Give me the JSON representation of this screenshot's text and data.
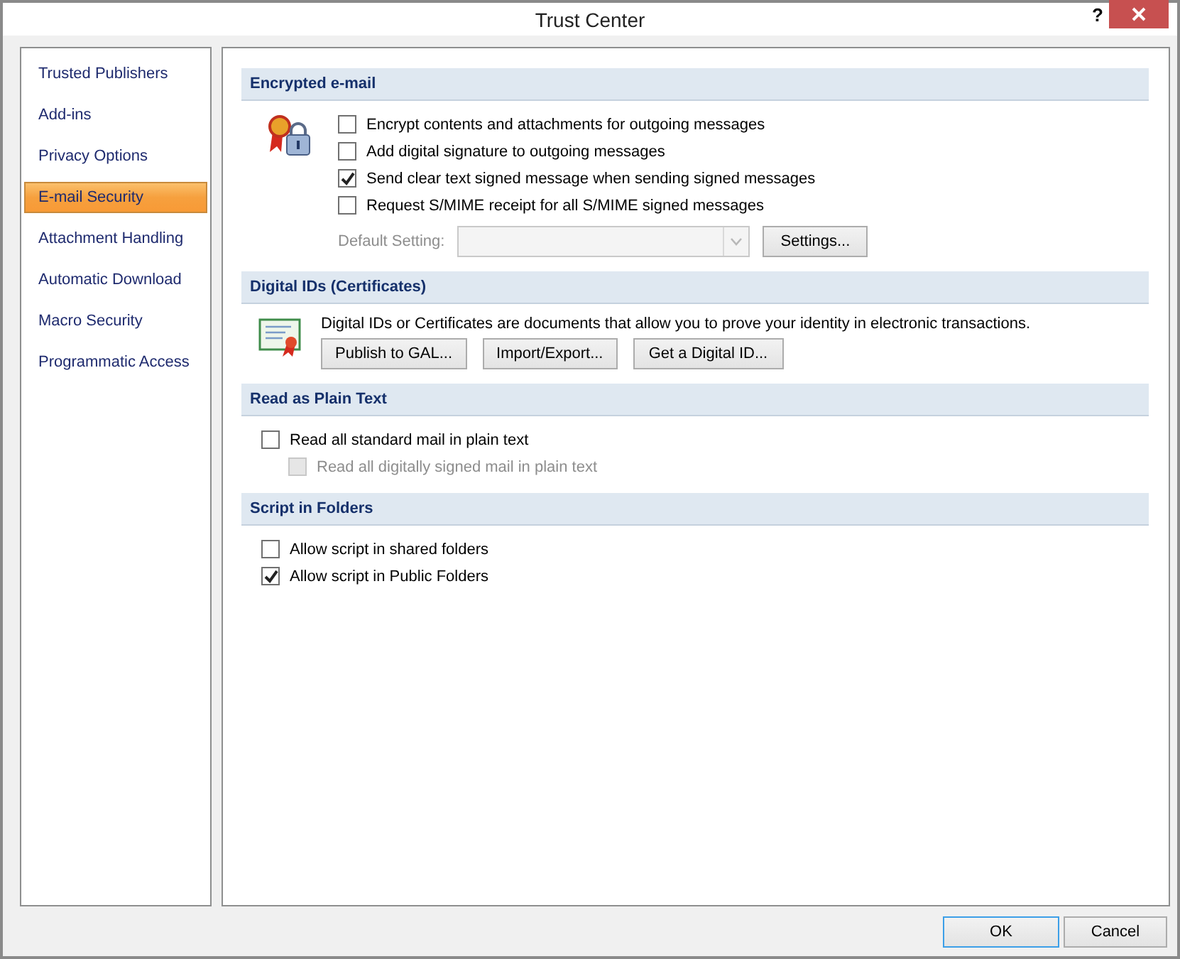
{
  "window": {
    "title": "Trust Center",
    "help": "?"
  },
  "sidebar": {
    "items": [
      {
        "label": "Trusted Publishers",
        "selected": false
      },
      {
        "label": "Add-ins",
        "selected": false
      },
      {
        "label": "Privacy Options",
        "selected": false
      },
      {
        "label": "E-mail Security",
        "selected": true
      },
      {
        "label": "Attachment Handling",
        "selected": false
      },
      {
        "label": "Automatic Download",
        "selected": false
      },
      {
        "label": "Macro Security",
        "selected": false
      },
      {
        "label": "Programmatic Access",
        "selected": false
      }
    ]
  },
  "sections": [
    {
      "title": "Encrypted e-mail",
      "kind": "encryption",
      "items": [
        {
          "kind": "checkbox",
          "label": "Encrypt contents and attachments for outgoing messages",
          "checked": false,
          "disabled": false
        },
        {
          "kind": "checkbox",
          "label": "Add digital signature to outgoing messages",
          "checked": false,
          "disabled": false
        },
        {
          "kind": "checkbox",
          "label": "Send clear text signed message when sending signed messages",
          "checked": true,
          "disabled": false
        },
        {
          "kind": "checkbox",
          "label": "Request S/MIME receipt for all S/MIME signed messages",
          "checked": false,
          "disabled": false
        },
        {
          "kind": "dropdown",
          "label": "Default Setting:",
          "disabled": true,
          "button": "Settings..."
        }
      ]
    },
    {
      "title": "Digital IDs (Certificates)",
      "kind": "certificates",
      "items": [
        {
          "kind": "text",
          "label": "Digital IDs or Certificates are documents that allow you to prove your identity in electronic transactions."
        },
        {
          "kind": "buttons",
          "buttons": [
            "Publish to GAL...",
            "Import/Export...",
            "Get a Digital ID..."
          ]
        }
      ]
    },
    {
      "title": "Read as Plain Text",
      "kind": "plain",
      "items": [
        {
          "kind": "checkbox",
          "label": "Read all standard mail in plain text",
          "checked": false,
          "disabled": false,
          "children": [
            {
              "kind": "checkbox",
              "label": "Read all digitally signed mail in plain text",
              "checked": false,
              "disabled": true
            }
          ]
        }
      ]
    },
    {
      "title": "Script in Folders",
      "kind": "plain",
      "items": [
        {
          "kind": "checkbox",
          "label": "Allow script in shared folders",
          "checked": false,
          "disabled": false
        },
        {
          "kind": "checkbox",
          "label": "Allow script in Public Folders",
          "checked": true,
          "disabled": false
        }
      ]
    }
  ],
  "footer": {
    "buttons": [
      {
        "label": "OK",
        "default": true
      },
      {
        "label": "Cancel",
        "default": false
      }
    ]
  }
}
